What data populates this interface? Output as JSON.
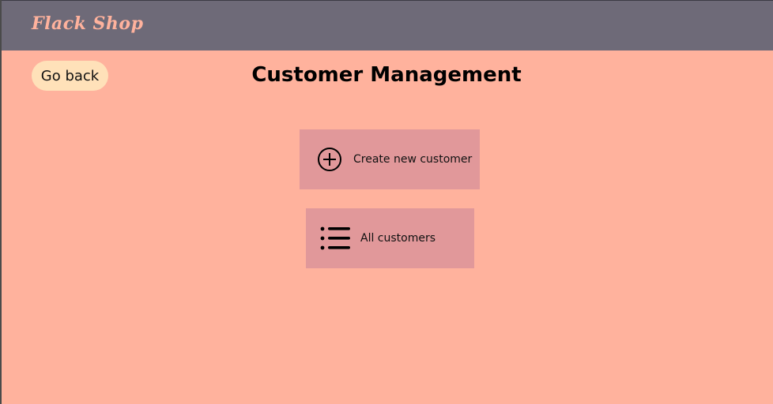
{
  "header": {
    "brand": "Flack Shop"
  },
  "nav": {
    "back_label": "Go back"
  },
  "main": {
    "title": "Customer Management",
    "actions": [
      {
        "label": "Create new customer",
        "icon": "plus-circle-icon"
      },
      {
        "label": "All customers",
        "icon": "list-icon"
      }
    ]
  },
  "colors": {
    "background": "#ffb29d",
    "topbar": "#6e6a78",
    "brand_text": "#ffb29d",
    "back_button": "#ffe1b9",
    "action_card": "#e1989a"
  }
}
